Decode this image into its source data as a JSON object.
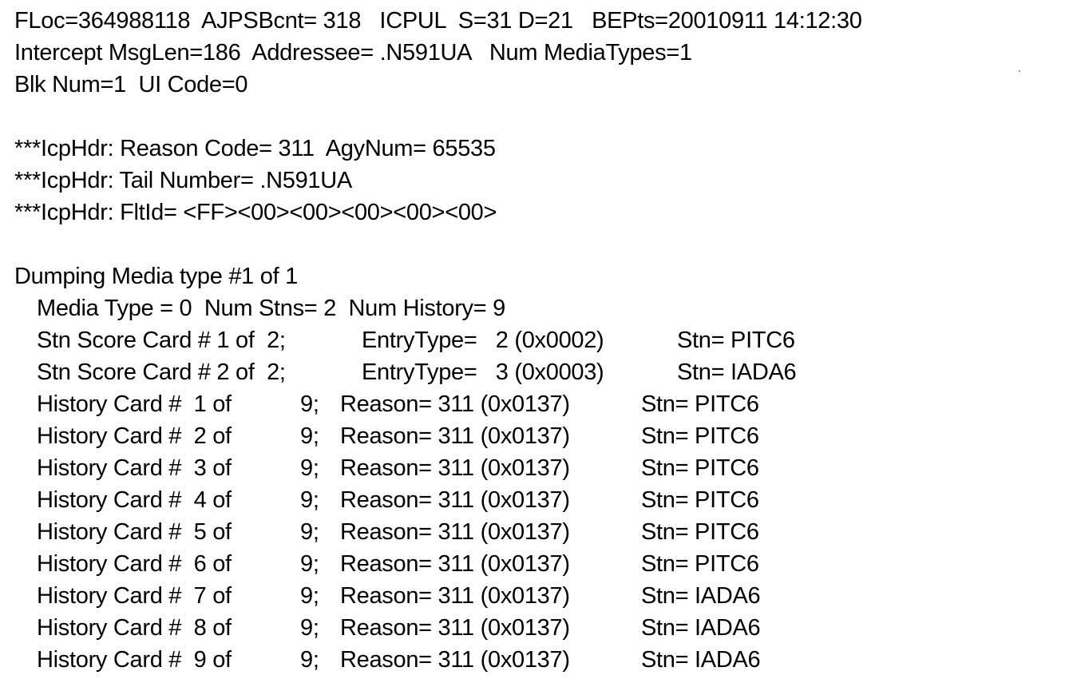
{
  "header": {
    "line1": "FLoc=364988118  AJPSBcnt= 318   ICPUL  S=31 D=21   BEPts=20010911 14:12:30",
    "line2": "Intercept MsgLen=186  Addressee= .N591UA   Num MediaTypes=1",
    "line3": "Blk Num=1  UI Code=0"
  },
  "icp_header": {
    "reason_line": "***IcpHdr: Reason Code= 311  AgyNum= 65535",
    "tail_line": "***IcpHdr: Tail Number= .N591UA",
    "fltid_line": "***IcpHdr: FltId= <FF><00><00><00><00><00>"
  },
  "media": {
    "dump_title": "Dumping Media type #1 of 1",
    "summary": "Media Type = 0  Num Stns= 2  Num History= 9",
    "score_cards": [
      {
        "label": "Stn Score Card # 1 of  2;",
        "entry": "EntryType=   2 (0x0002)",
        "stn": "Stn= PITC6"
      },
      {
        "label": "Stn Score Card # 2 of  2;",
        "entry": "EntryType=   3 (0x0003)",
        "stn": "Stn= IADA6"
      }
    ],
    "history_cards": [
      {
        "label": "History Card #  1 of",
        "total": "9;",
        "reason": "Reason= 311 (0x0137)",
        "stn": "Stn= PITC6"
      },
      {
        "label": "History Card #  2 of",
        "total": "9;",
        "reason": "Reason= 311 (0x0137)",
        "stn": "Stn= PITC6"
      },
      {
        "label": "History Card #  3 of",
        "total": "9;",
        "reason": "Reason= 311 (0x0137)",
        "stn": "Stn= PITC6"
      },
      {
        "label": "History Card #  4 of",
        "total": "9;",
        "reason": "Reason= 311 (0x0137)",
        "stn": "Stn= PITC6"
      },
      {
        "label": "History Card #  5 of",
        "total": "9;",
        "reason": "Reason= 311 (0x0137)",
        "stn": "Stn= PITC6"
      },
      {
        "label": "History Card #  6 of",
        "total": "9;",
        "reason": "Reason= 311 (0x0137)",
        "stn": "Stn= PITC6"
      },
      {
        "label": "History Card #  7 of",
        "total": "9;",
        "reason": "Reason= 311 (0x0137)",
        "stn": "Stn= IADA6"
      },
      {
        "label": "History Card #  8 of",
        "total": "9;",
        "reason": "Reason= 311 (0x0137)",
        "stn": "Stn= IADA6"
      },
      {
        "label": "History Card #  9 of",
        "total": "9;",
        "reason": "Reason= 311 (0x0137)",
        "stn": "Stn= IADA6"
      }
    ]
  }
}
